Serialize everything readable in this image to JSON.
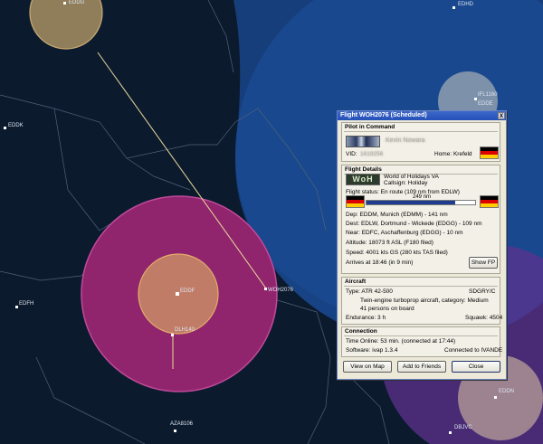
{
  "map": {
    "labels": [
      "EDDG",
      "EDDK",
      "EDFH",
      "EDDF",
      "WOH2076",
      "DLH140",
      "AZA8106",
      "IFL1160",
      "EDDE",
      "EDDN",
      "DBJVC",
      "EDHD"
    ]
  },
  "dialog": {
    "title": "Flight WOH2076 (Scheduled)",
    "close_glyph": "X",
    "pilot": {
      "heading": "Pilot in Command",
      "name": "Kevin Nowara",
      "vid_label": "VID:",
      "vid_value": "1619256",
      "home_label": "Home: Krefeld"
    },
    "flight": {
      "heading": "Flight Details",
      "logo_text": "WoH",
      "va_line": "World of Holidays VA",
      "callsign_line": "Callsign: Holiday",
      "status": "Flight status: En route (109 nm from EDLW)",
      "distance": "249 nm",
      "progress_fraction": 0.82,
      "dep": "Dep: EDDM, Munich (EDMM) - 141 nm",
      "dest": "Dest: EDLW, Dortmund - Wickede (EDGG) - 109 nm",
      "near": "Near: EDFC, Aschaffenburg (EDGG) - 10 nm",
      "altitude": "Altitude: 18073 ft ASL (F180 filed)",
      "speed": "Speed: 4001 kts GS (280 kts TAS filed)",
      "arrives": "Arrives at 18:46 (in 9 min)",
      "show_fp": "Show FP"
    },
    "aircraft": {
      "heading": "Aircraft",
      "type": "Type: ATR 42-500",
      "reg": "SDGRY/C",
      "desc": "Twin-engine turboprop aircraft, category: Medium",
      "persons": "41 persons on board",
      "endurance": "Endurance: 3 h",
      "squawk": "Squawk: 4504"
    },
    "connection": {
      "heading": "Connection",
      "time": "Time Online: 53 min. (connected at 17:44)",
      "software": "Software: ivap 1.3.4",
      "connected_to": "Connected to IVANDE"
    },
    "buttons": {
      "view_map": "View on Map",
      "add_friends": "Add to Friends",
      "close": "Close"
    }
  }
}
